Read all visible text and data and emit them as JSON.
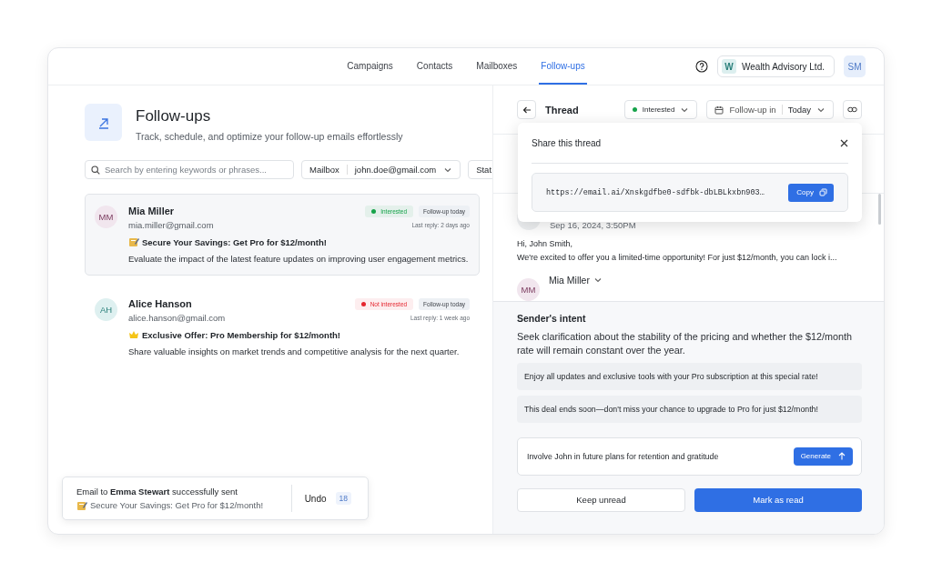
{
  "nav": {
    "tabs": [
      {
        "label": "Campaigns",
        "selected": false
      },
      {
        "label": "Contacts",
        "selected": false
      },
      {
        "label": "Mailboxes",
        "selected": false
      },
      {
        "label": "Follow-ups",
        "selected": true
      }
    ],
    "org": {
      "initial": "W",
      "name": "Wealth Advisory Ltd."
    },
    "user_initials": "SM"
  },
  "page": {
    "title": "Follow-ups",
    "subtitle": "Track, schedule, and optimize your follow-up emails effortlessly"
  },
  "filters": {
    "search_placeholder": "Search by entering keywords or phrases...",
    "mailbox_label": "Mailbox",
    "mailbox_value": "john.doe@gmail.com",
    "status_label": "Stat"
  },
  "conversations": [
    {
      "initials": "MM",
      "name": "Mia Miller",
      "email": "mia.miller@gmail.com",
      "status": "Interested",
      "color": "#16a34a",
      "followup": "Follow-up today",
      "last_reply": "Last reply: 2 days ago",
      "subject": "Secure Your Savings: Get Pro for $12/month!",
      "preview": "Evaluate the impact of the latest feature updates on improving user engagement metrics.",
      "selected": true
    },
    {
      "initials": "AH",
      "name": "Alice Hanson",
      "email": "alice.hanson@gmail.com",
      "status": "Not interested",
      "color": "#e5262f",
      "followup": "Follow-up today",
      "last_reply": "Last reply: 1 week ago",
      "subject": "Exclusive Offer: Pro Membership for $12/month!",
      "preview": "Share valuable insights on market trends and competitive analysis for the next quarter.",
      "selected": false
    }
  ],
  "toast": {
    "message": "Email to **Emma Stewart** successfully sent",
    "subject": "Secure Your Savings: Get Pro for $12/month!",
    "action": "Undo",
    "countdown": "18"
  },
  "thread": {
    "title": "Thread",
    "status": "Interested",
    "color": "#16a34a",
    "followup_label": "Follow-up in",
    "followup_value": "Today",
    "messages": [
      {
        "date": "Sep 16, 2024, 3:50PM",
        "greeting": "Hi, John Smith,",
        "body": "We're excited to offer you a limited-time opportunity! For just $12/month, you can lock i..."
      },
      {
        "initials": "MM",
        "name": "Mia Miller"
      }
    ]
  },
  "share": {
    "title": "Share this thread",
    "url": "https://email.ai/Xnskgdfbe0-sdfbk-dbLBLkxbn903…",
    "copy": "Copy"
  },
  "intent": {
    "title": "Sender's intent",
    "summary": "Seek clarification about the stability of the pricing and whether the $12/month rate will remain constant over the year.",
    "suggestions": [
      "Enjoy all updates and exclusive tools with your Pro subscription at this special rate!",
      "This deal ends soon—don't miss your chance to upgrade to Pro for just $12/month!"
    ],
    "prompt": "Involve John in future plans for retention and gratitude",
    "generate": "Generate"
  },
  "actions": {
    "secondary": "Keep unread",
    "primary": "Mark as read"
  }
}
